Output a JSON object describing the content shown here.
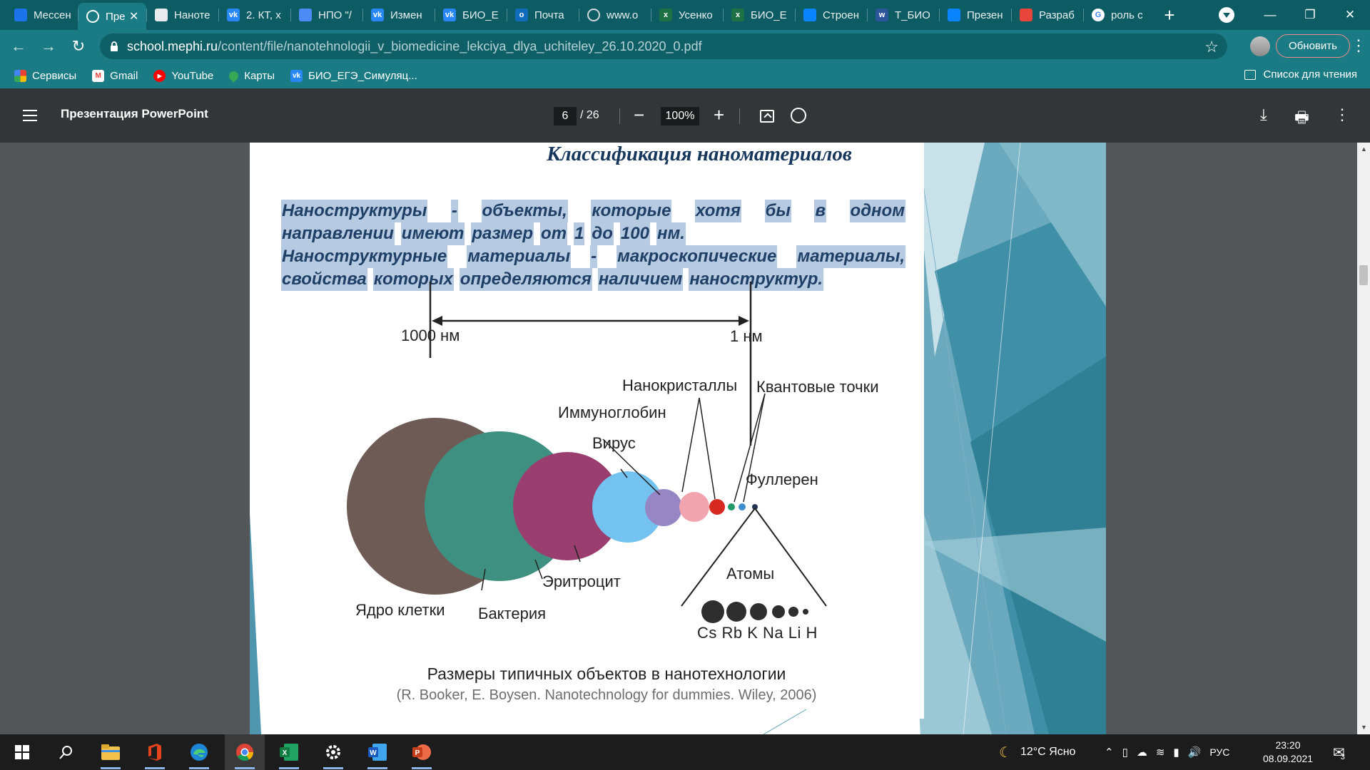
{
  "browser": {
    "tabs": [
      {
        "label": "Мессен",
        "icon": "messenger-icon",
        "color": "#1a73e8"
      },
      {
        "label": "Пре",
        "icon": "globe-icon",
        "color": "#ffffff",
        "active": true
      },
      {
        "label": "Наноте",
        "icon": "document-icon",
        "color": "#e8eaed"
      },
      {
        "label": "2. КТ, х",
        "icon": "vk-icon",
        "color": "#2787f5"
      },
      {
        "label": "НПО \"/",
        "icon": "npo-icon",
        "color": "#4c8bf5"
      },
      {
        "label": "Измен",
        "icon": "vk-icon",
        "color": "#2787f5"
      },
      {
        "label": "БИО_Е",
        "icon": "vk-icon",
        "color": "#2787f5"
      },
      {
        "label": "Почта",
        "icon": "outlook-icon",
        "color": "#0f6cbd"
      },
      {
        "label": "www.o",
        "icon": "globe-icon",
        "color": "#9aa0a6"
      },
      {
        "label": "Усенко",
        "icon": "excel-icon",
        "color": "#1e7145"
      },
      {
        "label": "БИО_Е",
        "icon": "excel-icon",
        "color": "#1e7145"
      },
      {
        "label": "Строен",
        "icon": "onedrive-icon",
        "color": "#0a84ff"
      },
      {
        "label": "Т_БИО",
        "icon": "word-icon",
        "color": "#2b579a"
      },
      {
        "label": "Презен",
        "icon": "onedrive-icon",
        "color": "#0a84ff"
      },
      {
        "label": "Разраб",
        "icon": "bookmark-icon",
        "color": "#e8453c"
      },
      {
        "label": "роль с",
        "icon": "google-icon",
        "color": "#ffffff"
      }
    ],
    "url_host": "school.mephi.ru",
    "url_path": "/content/file/nanotehnologii_v_biomedicine_lekciya_dlya_uchiteley_26.10.2020_0.pdf",
    "update_label": "Обновить",
    "bookmarks": [
      {
        "label": "Сервисы",
        "icon": "apps-grid-icon",
        "color": "#ea4335"
      },
      {
        "label": "Gmail",
        "icon": "gmail-icon",
        "color": "#ea4335"
      },
      {
        "label": "YouTube",
        "icon": "youtube-icon",
        "color": "#ff0000"
      },
      {
        "label": "Карты",
        "icon": "maps-pin-icon",
        "color": "#34a853"
      },
      {
        "label": "БИО_ЕГЭ_Симуляц...",
        "icon": "vk-icon",
        "color": "#2787f5"
      }
    ],
    "reading_list_label": "Список для чтения"
  },
  "pdf_viewer": {
    "title": "Презентация PowerPoint",
    "current_page": "6",
    "total_pages": "/ 26",
    "zoom": "100%"
  },
  "slide": {
    "title": "Классификация наноматериалов",
    "definition_lines": [
      [
        "Наноструктуры",
        "-",
        "объекты,",
        "которые",
        "хотя",
        "бы",
        "в",
        "одном"
      ],
      [
        "направлении",
        "имеют",
        "размер",
        "от",
        "1",
        "до",
        "100",
        "нм."
      ],
      [
        "Наноструктурные",
        "материалы",
        "-",
        "макроскопические",
        "материалы,"
      ],
      [
        "свойства",
        "которых",
        "определяются",
        "наличием",
        "наноструктур."
      ]
    ],
    "figure": {
      "scale_left": "1000 нм",
      "scale_right": "1 нм",
      "labels": {
        "nanocrystals": "Нанокристаллы",
        "quantum_dots": "Квантовые точки",
        "immunoglobulin": "Иммуноглобин",
        "virus": "Вирус",
        "fullerene": "Фуллерен",
        "atoms": "Атомы",
        "erythrocyte": "Эритроцит",
        "cell_nucleus": "Ядро клетки",
        "bacterium": "Бактерия",
        "atom_symbols": "Cs Rb K Na Li H"
      },
      "colors": {
        "nucleus": "#6f5b55",
        "bacterium": "#3e9180",
        "erythrocyte": "#9a3e70",
        "virus": "#74c2ef",
        "immunoglobulin": "#9786c4",
        "nanocrystal_pink": "#f2a4ae",
        "nanocrystal_red": "#d72b22",
        "quantum_dot_green": "#1f9a66",
        "quantum_dot_blue": "#3b8dd0",
        "fullerene": "#223355",
        "atoms": "#2e2e2e"
      },
      "caption": "Размеры типичных объектов в нанотехнологии",
      "source": "(R. Booker, E. Boysen. Nanotechnology for dummies. Wiley, 2006)"
    }
  },
  "taskbar": {
    "apps": [
      {
        "name": "start-button",
        "icon": "windows-icon"
      },
      {
        "name": "search-button",
        "icon": "search-icon"
      },
      {
        "name": "explorer-app",
        "icon": "folder-icon"
      },
      {
        "name": "office-app",
        "icon": "office-icon"
      },
      {
        "name": "edge-app",
        "icon": "edge-icon"
      },
      {
        "name": "chrome-app",
        "icon": "chrome-icon"
      },
      {
        "name": "excel-app",
        "icon": "excel-icon"
      },
      {
        "name": "settings-app",
        "icon": "gear-icon"
      },
      {
        "name": "word-app",
        "icon": "word-icon"
      },
      {
        "name": "powerpoint-app",
        "icon": "powerpoint-icon"
      }
    ],
    "weather": "12°C Ясно",
    "language": "РУС",
    "time": "23:20",
    "date": "08.09.2021",
    "notification_count": "3"
  }
}
